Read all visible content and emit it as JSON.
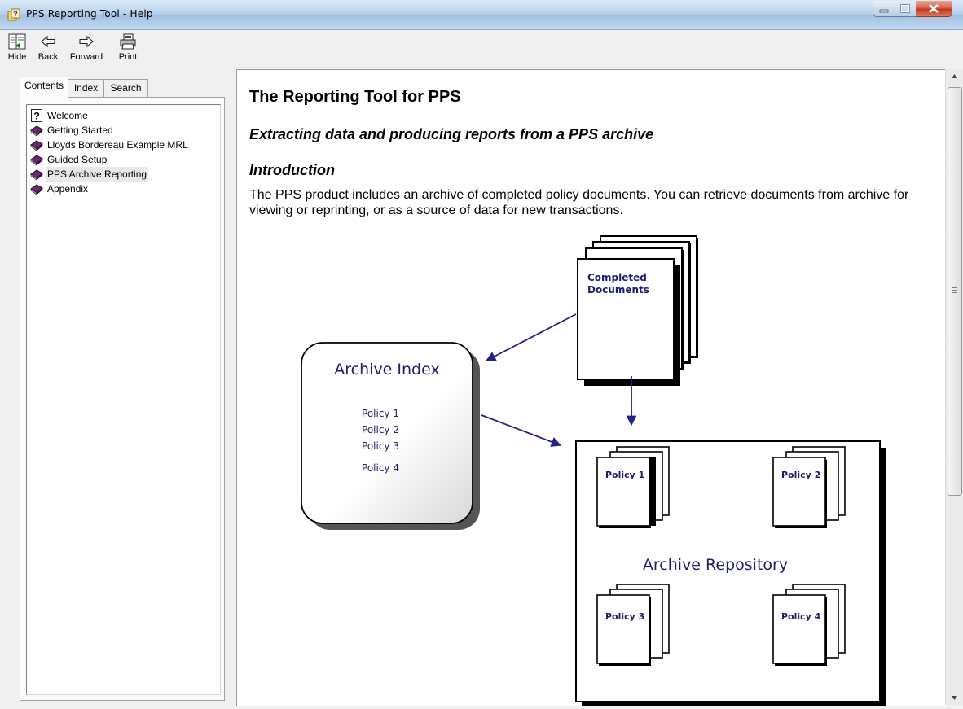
{
  "window": {
    "title": "PPS Reporting Tool - Help"
  },
  "toolbar": {
    "hide": "Hide",
    "back": "Back",
    "forward": "Forward",
    "print": "Print"
  },
  "tabs": {
    "contents": "Contents",
    "index": "Index",
    "search": "Search"
  },
  "tree": {
    "items": [
      {
        "label": "Welcome",
        "icon": "help-page-icon"
      },
      {
        "label": "Getting Started",
        "icon": "book-icon"
      },
      {
        "label": "Lloyds Bordereau Example MRL",
        "icon": "book-icon"
      },
      {
        "label": "Guided Setup",
        "icon": "book-icon"
      },
      {
        "label": "PPS Archive Reporting",
        "icon": "book-icon",
        "selected": true
      },
      {
        "label": "Appendix",
        "icon": "book-icon"
      }
    ]
  },
  "article": {
    "title": "The Reporting Tool for PPS",
    "subtitle": "Extracting data and producing reports from a PPS archive",
    "section": "Introduction",
    "paragraph": "The PPS product includes an archive of completed policy documents. You can retrieve documents from archive for viewing or reprinting, or as a source of data for new transactions."
  },
  "diagram": {
    "completed_line1": "Completed",
    "completed_line2": "Documents",
    "index_title": "Archive Index",
    "index_policies": [
      "Policy 1",
      "Policy 2",
      "Policy 3",
      "Policy 4"
    ],
    "repository_title": "Archive Repository",
    "repository_policies": [
      "Policy 1",
      "Policy 2",
      "Policy 3",
      "Policy 4"
    ]
  },
  "colors": {
    "diagram_text": "#1f1f6e",
    "arrow": "#23238a",
    "book": "#6a2a6a"
  }
}
